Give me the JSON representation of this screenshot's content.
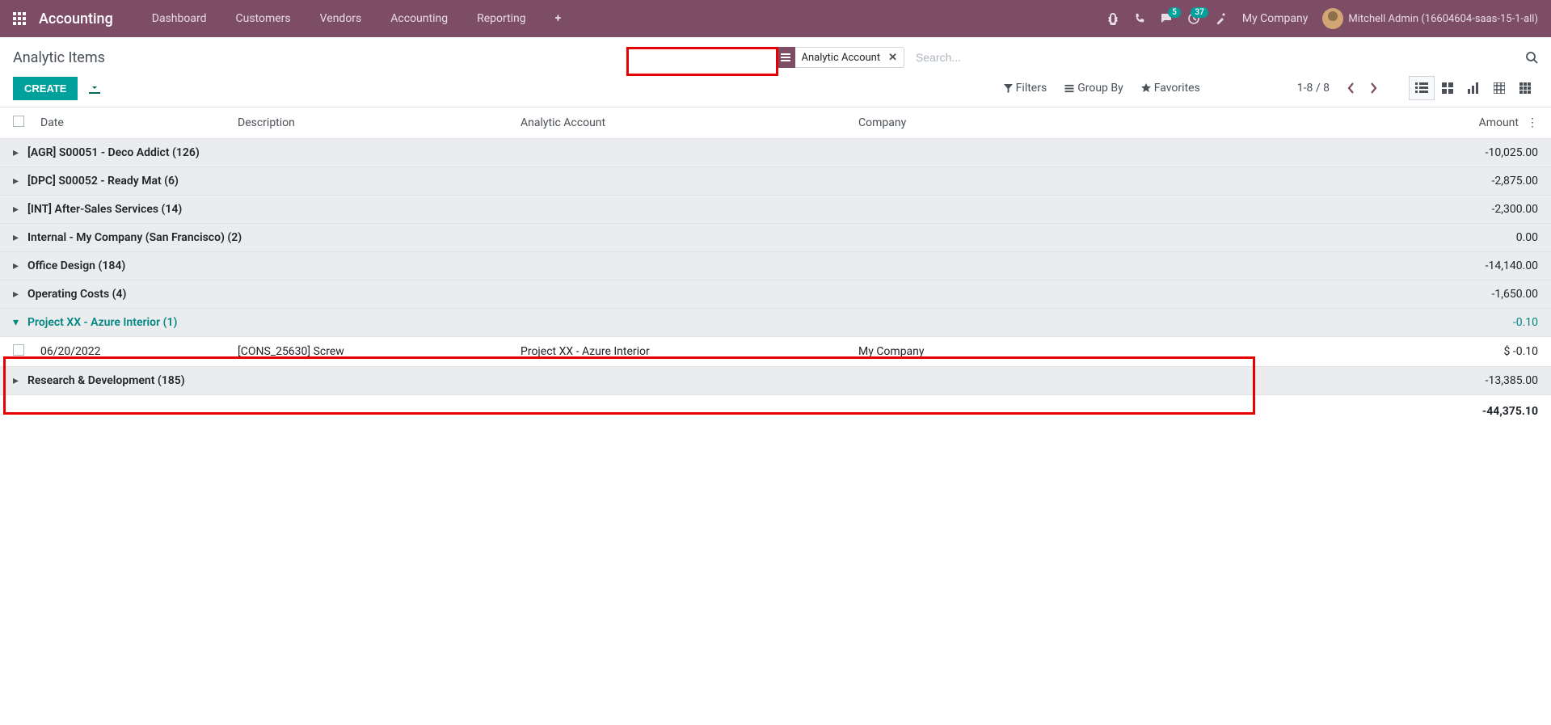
{
  "navbar": {
    "brand": "Accounting",
    "links": [
      "Dashboard",
      "Customers",
      "Vendors",
      "Accounting",
      "Reporting"
    ],
    "msg_badge": "5",
    "act_badge": "37",
    "company": "My Company",
    "user": "Mitchell Admin (16604604-saas-15-1-all)"
  },
  "page": {
    "title": "Analytic Items",
    "create": "CREATE",
    "facet": "Analytic Account",
    "search_ph": "Search...",
    "filters": "Filters",
    "groupby": "Group By",
    "favorites": "Favorites",
    "pager": "1-8 / 8"
  },
  "columns": {
    "date": "Date",
    "desc": "Description",
    "acc": "Analytic Account",
    "comp": "Company",
    "amt": "Amount"
  },
  "groups": [
    {
      "label": "[AGR] S00051 - Deco Addict (126)",
      "amount": "-10,025.00",
      "open": false
    },
    {
      "label": "[DPC] S00052 - Ready Mat (6)",
      "amount": "-2,875.00",
      "open": false
    },
    {
      "label": "[INT] After-Sales Services (14)",
      "amount": "-2,300.00",
      "open": false
    },
    {
      "label": "Internal - My Company (San Francisco) (2)",
      "amount": "0.00",
      "open": false
    },
    {
      "label": "Office Design (184)",
      "amount": "-14,140.00",
      "open": false
    },
    {
      "label": "Operating Costs (4)",
      "amount": "-1,650.00",
      "open": false
    },
    {
      "label": "Project XX - Azure Interior (1)",
      "amount": "-0.10",
      "open": true
    },
    {
      "label": "Research & Development (185)",
      "amount": "-13,385.00",
      "open": false
    }
  ],
  "row": {
    "date": "06/20/2022",
    "desc": "[CONS_25630] Screw",
    "acc": "Project XX - Azure Interior",
    "comp": "My Company",
    "amt": "$ -0.10"
  },
  "total": "-44,375.10"
}
